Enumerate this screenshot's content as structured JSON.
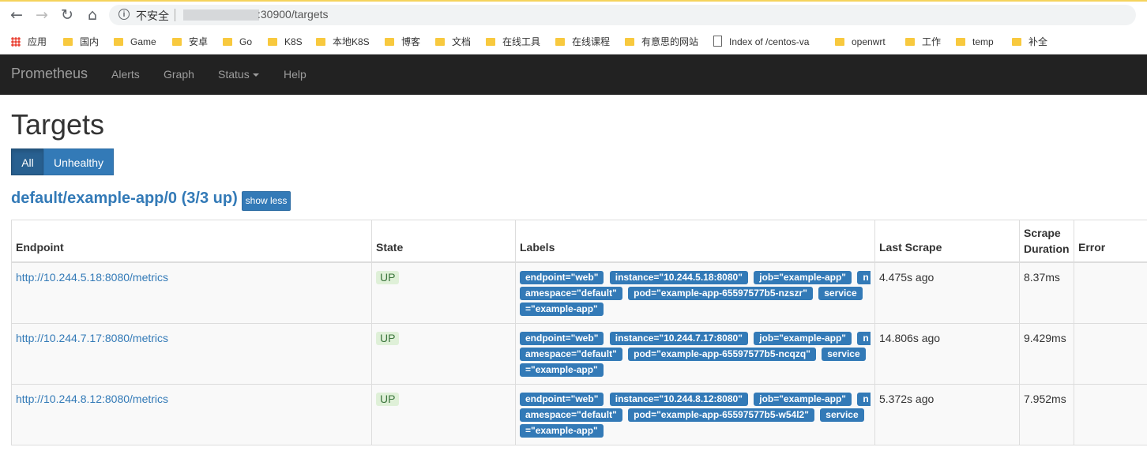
{
  "browser": {
    "insecure_label": "不安全",
    "url_suffix": ":30900/targets"
  },
  "bookmarks": [
    {
      "label": "应用",
      "icon": "apps-icon"
    },
    {
      "label": "国内",
      "icon": "folder-icon"
    },
    {
      "label": "Game",
      "icon": "folder-icon"
    },
    {
      "label": "安卓",
      "icon": "folder-icon"
    },
    {
      "label": "Go",
      "icon": "folder-icon"
    },
    {
      "label": "K8S",
      "icon": "folder-icon"
    },
    {
      "label": "本地K8S",
      "icon": "folder-icon"
    },
    {
      "label": "博客",
      "icon": "folder-icon"
    },
    {
      "label": "文档",
      "icon": "folder-icon"
    },
    {
      "label": "在线工具",
      "icon": "folder-icon"
    },
    {
      "label": "在线课程",
      "icon": "folder-icon"
    },
    {
      "label": "有意思的网站",
      "icon": "folder-icon"
    },
    {
      "label": "Index of /centos-va",
      "icon": "document-icon"
    },
    {
      "label": "openwrt",
      "icon": "folder-icon"
    },
    {
      "label": "工作",
      "icon": "folder-icon"
    },
    {
      "label": "temp",
      "icon": "folder-icon"
    },
    {
      "label": "补全",
      "icon": "folder-icon"
    }
  ],
  "nav": {
    "brand": "Prometheus",
    "links": [
      "Alerts",
      "Graph",
      "Status",
      "Help"
    ]
  },
  "page": {
    "title": "Targets",
    "filters": [
      "All",
      "Unhealthy"
    ],
    "active_filter": "All"
  },
  "group": {
    "heading": "default/example-app/0 (3/3 up)",
    "toggle_label": "show less",
    "columns": [
      "Endpoint",
      "State",
      "Labels",
      "Last Scrape",
      "Scrape Duration",
      "Error"
    ],
    "rows": [
      {
        "endpoint": "http://10.244.5.18:8080/metrics",
        "state": "UP",
        "labels": [
          "endpoint=\"web\"",
          "instance=\"10.244.5.18:8080\"",
          "job=\"example-app\"",
          "namespace=\"default\"",
          "pod=\"example-app-65597577b5-nzszr\"",
          "service=\"example-app\""
        ],
        "last_scrape": "4.475s ago",
        "duration": "8.37ms",
        "error": ""
      },
      {
        "endpoint": "http://10.244.7.17:8080/metrics",
        "state": "UP",
        "labels": [
          "endpoint=\"web\"",
          "instance=\"10.244.7.17:8080\"",
          "job=\"example-app\"",
          "namespace=\"default\"",
          "pod=\"example-app-65597577b5-ncqzq\"",
          "service=\"example-app\""
        ],
        "last_scrape": "14.806s ago",
        "duration": "9.429ms",
        "error": ""
      },
      {
        "endpoint": "http://10.244.8.12:8080/metrics",
        "state": "UP",
        "labels": [
          "endpoint=\"web\"",
          "instance=\"10.244.8.12:8080\"",
          "job=\"example-app\"",
          "namespace=\"default\"",
          "pod=\"example-app-65597577b5-w54l2\"",
          "service=\"example-app\""
        ],
        "last_scrape": "5.372s ago",
        "duration": "7.952ms",
        "error": ""
      }
    ]
  },
  "colors": {
    "navbar_bg": "#222222",
    "link": "#337ab7",
    "up_bg": "#dff0d8",
    "up_text": "#3c763d"
  }
}
